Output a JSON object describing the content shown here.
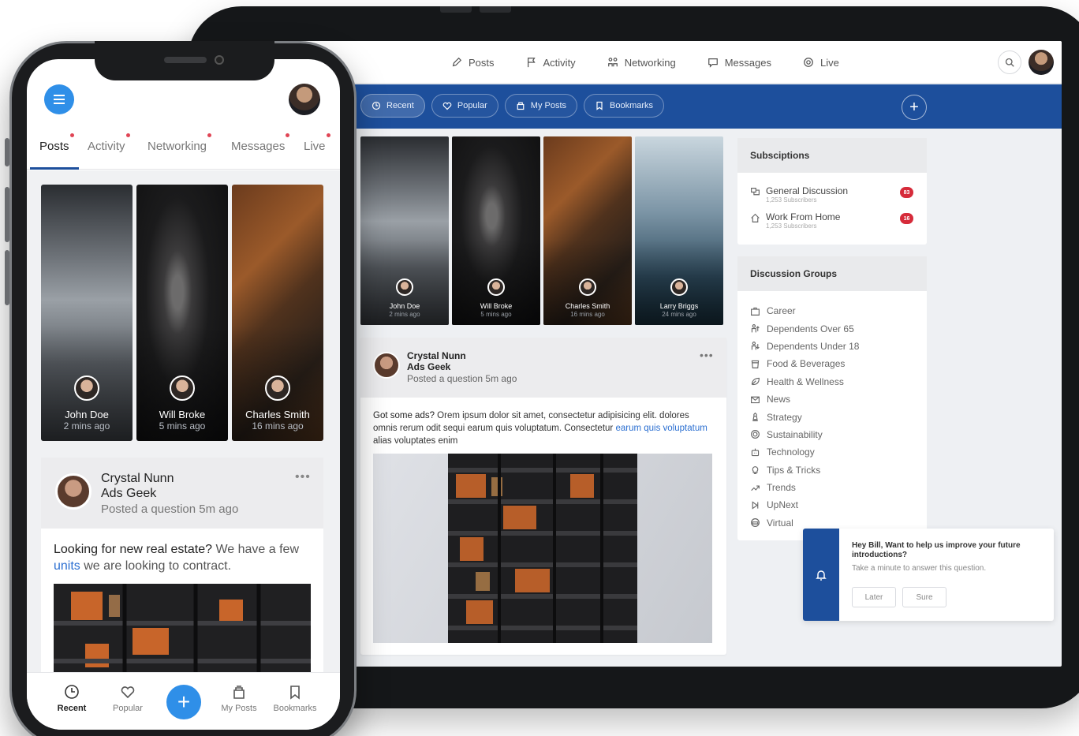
{
  "tablet": {
    "nav": [
      {
        "label": "Posts",
        "icon": "pencil-icon"
      },
      {
        "label": "Activity",
        "icon": "flag-icon"
      },
      {
        "label": "Networking",
        "icon": "people-icon"
      },
      {
        "label": "Messages",
        "icon": "chat-icon"
      },
      {
        "label": "Live",
        "icon": "broadcast-icon"
      }
    ],
    "filters": [
      {
        "label": "Recent",
        "icon": "clock-icon",
        "active": true
      },
      {
        "label": "Popular",
        "icon": "heart-icon",
        "active": false
      },
      {
        "label": "My Posts",
        "icon": "bag-icon",
        "active": false
      },
      {
        "label": "Bookmarks",
        "icon": "bookmark-icon",
        "active": false
      }
    ],
    "stories": [
      {
        "name": "John Doe",
        "time": "2 mins ago"
      },
      {
        "name": "Will Broke",
        "time": "5 mins ago"
      },
      {
        "name": "Charles Smith",
        "time": "16 mins ago"
      },
      {
        "name": "Larry Briggs",
        "time": "24 mins ago"
      }
    ],
    "post": {
      "name": "Crystal Nunn",
      "role": "Ads Geek",
      "meta": "Posted a question 5m ago",
      "more": "•••",
      "lead": "Got some ads?",
      "body1": " Orem ipsum dolor sit amet, consectetur adipisicing elit. dolores omnis rerum odit sequi earum quis voluptatum. Consectetur ",
      "link": "earum quis voluptatum",
      "body2": " alias voluptates enim"
    },
    "subscriptions": {
      "title": "Subsciptions",
      "items": [
        {
          "title": "General Discussion",
          "count": "1,253 Subscribers",
          "badge": "83"
        },
        {
          "title": "Work From Home",
          "count": "1,253 Subscribers",
          "badge": "16"
        }
      ]
    },
    "groups": {
      "title": "Discussion Groups",
      "items": [
        "Career",
        "Dependents Over 65",
        "Dependents Under 18",
        "Food & Beverages",
        "Health & Wellness",
        "News",
        "Strategy",
        "Sustainability",
        "Technology",
        "Tips & Tricks",
        "Trends",
        "UpNext",
        "Virtual"
      ]
    },
    "toast": {
      "title": "Hey Bill, Want to help us improve your future introductions?",
      "body": "Take a minute to answer this question.",
      "later": "Later",
      "sure": "Sure"
    },
    "fab": "+"
  },
  "phone": {
    "tabs": [
      "Posts",
      "Activity",
      "Networking",
      "Messages",
      "Live"
    ],
    "stories": [
      {
        "name": "John Doe",
        "time": "2 mins ago"
      },
      {
        "name": "Will Broke",
        "time": "5 mins ago"
      },
      {
        "name": "Charles Smith",
        "time": "16 mins ago"
      }
    ],
    "post": {
      "name": "Crystal Nunn",
      "role": "Ads Geek",
      "meta": "Posted a question 5m ago",
      "more": "•••",
      "lead": "Looking for new real estate?",
      "body1": " We have a few ",
      "link": "units",
      "body2": " we are looking to contract."
    },
    "bottom_nav": [
      {
        "label": "Recent",
        "icon": "clock-icon",
        "active": true
      },
      {
        "label": "Popular",
        "icon": "heart-icon",
        "active": false
      },
      {
        "label": "My Posts",
        "icon": "bag-icon",
        "active": false
      },
      {
        "label": "Bookmarks",
        "icon": "bookmark-icon",
        "active": false
      }
    ],
    "fab": "+"
  },
  "colors": {
    "brand_blue": "#1d4f9c",
    "accent_blue": "#2f8fe8",
    "badge_red": "#d62b3a"
  }
}
